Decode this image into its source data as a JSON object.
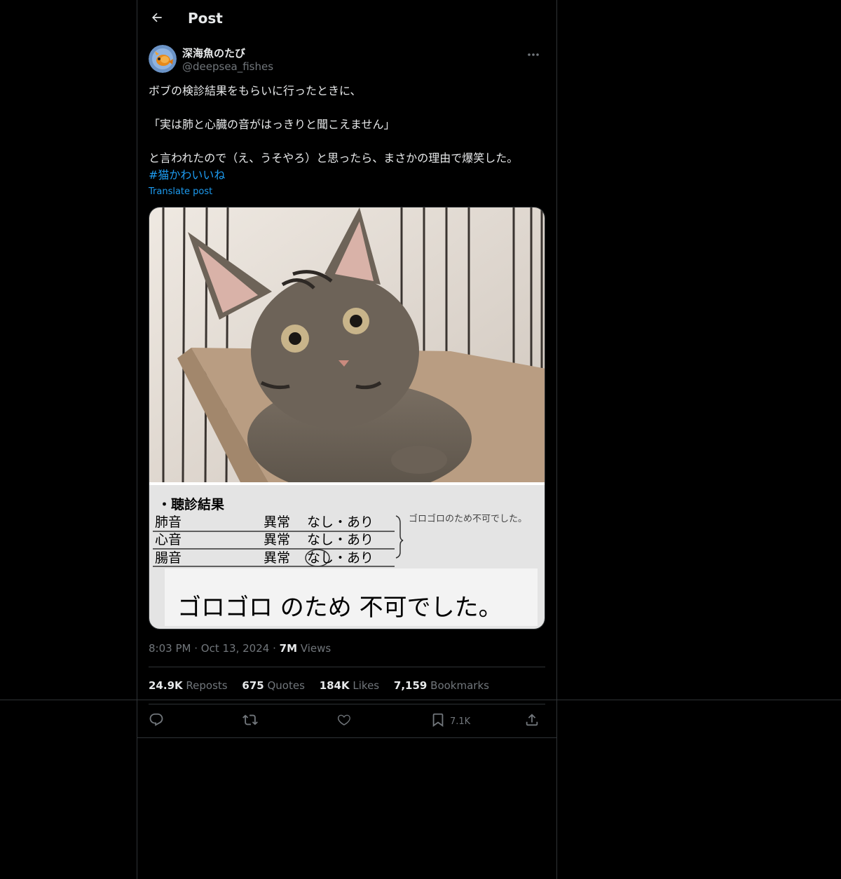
{
  "header": {
    "title": "Post"
  },
  "author": {
    "name": "深海魚のたび",
    "handle": "@deepsea_fishes"
  },
  "tweet": {
    "lines": [
      "ボブの検診結果をもらいに行ったときに、",
      "「実は肺と心臓の音がはっきりと聞こえません」",
      "と言われたので（え、うそやろ）と思ったら、まさかの理由で爆笑した。"
    ],
    "hashtag": "#猫かわいいね",
    "translate_label": "Translate post"
  },
  "media": {
    "report_heading": "・聴診結果",
    "rows": [
      {
        "label": "肺音",
        "abnormal": "異常",
        "options": "なし・あり"
      },
      {
        "label": "心音",
        "abnormal": "異常",
        "options": "なし・あり"
      },
      {
        "label": "腸音",
        "abnormal": "異常",
        "options": "なし・あり"
      }
    ],
    "side_note": "ゴロゴロのため不可でした。",
    "handwritten_note": "ゴロゴロ のため 不可でした。"
  },
  "meta": {
    "time": "8:03 PM",
    "date": "Oct 13, 2024",
    "views_count": "7M",
    "views_label": "Views",
    "separator": "·"
  },
  "stats": {
    "reposts_count": "24.9K",
    "reposts_label": "Reposts",
    "quotes_count": "675",
    "quotes_label": "Quotes",
    "likes_count": "184K",
    "likes_label": "Likes",
    "bookmarks_count": "7,159",
    "bookmarks_label": "Bookmarks"
  },
  "actions": {
    "bookmark_count": "7.1K"
  },
  "colors": {
    "accent": "#1d9bf0",
    "text": "#e7e9ea",
    "muted": "#71767b",
    "border": "#2f3336",
    "background": "#000000"
  }
}
